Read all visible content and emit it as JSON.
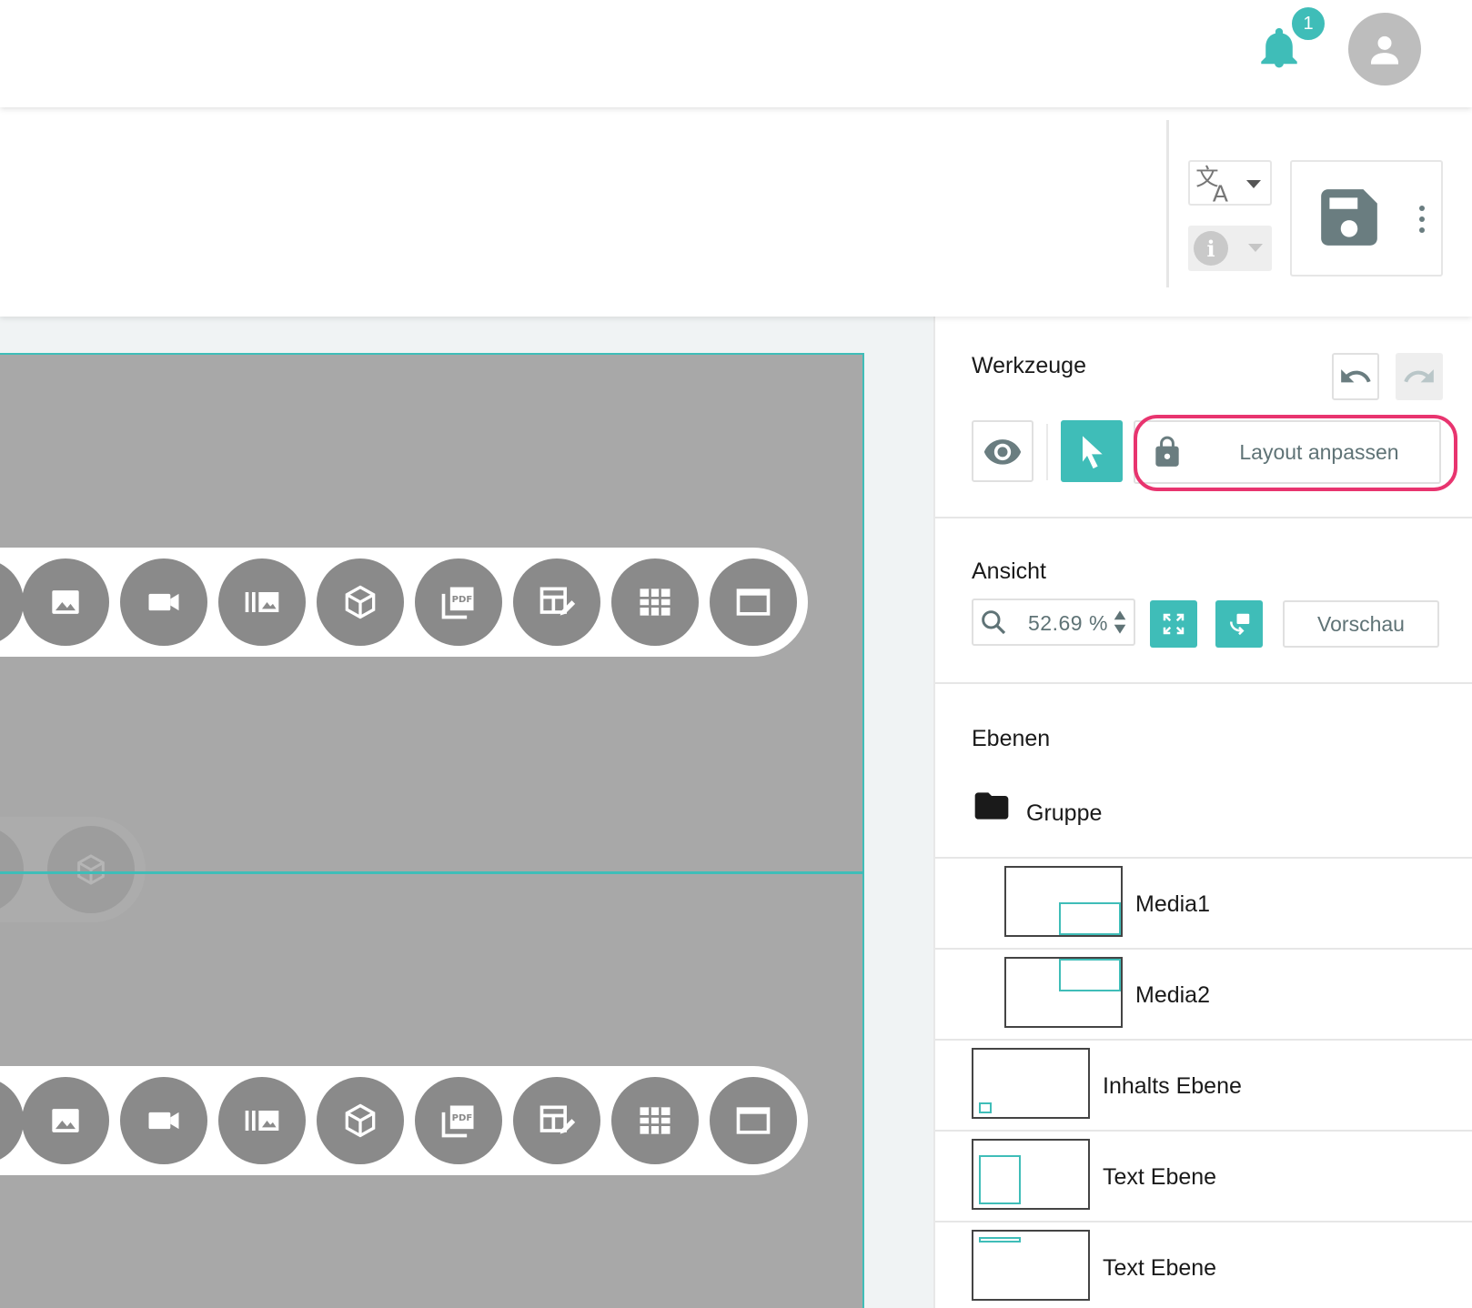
{
  "header": {
    "notification_count": "1"
  },
  "toolbar": {
    "save_label": "Speichern"
  },
  "canvas": {
    "widget_bars": [
      {
        "name": "widget-bar-top"
      },
      {
        "name": "widget-bar-bottom"
      }
    ]
  },
  "panel": {
    "tools": {
      "title": "Werkzeuge",
      "layout_button": "Layout anpassen"
    },
    "view": {
      "title": "Ansicht",
      "zoom": "52.69 %",
      "preview_button": "Vorschau"
    },
    "layers": {
      "title": "Ebenen",
      "group_label": "Gruppe",
      "items": [
        {
          "label": "Media1"
        },
        {
          "label": "Media2"
        },
        {
          "label": "Inhalts Ebene"
        },
        {
          "label": "Text Ebene"
        },
        {
          "label": "Text Ebene"
        }
      ]
    }
  },
  "colors": {
    "accent": "#3fbdb8",
    "highlight": "#e8346f",
    "canvas_bg": "#a8a8a8",
    "widget_icon_bg": "#8a8a8a"
  }
}
